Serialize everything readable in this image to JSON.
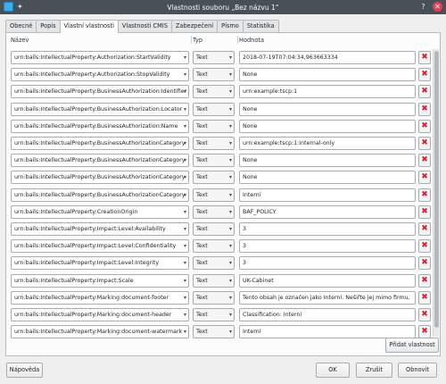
{
  "window": {
    "title": "Vlastnosti souboru „Bez názvu 1“"
  },
  "tabs": [
    {
      "label": "Obecné",
      "active": false
    },
    {
      "label": "Popis",
      "active": false
    },
    {
      "label": "Vlastní vlastnosti",
      "active": true
    },
    {
      "label": "Vlastnosti CMIS",
      "active": false
    },
    {
      "label": "Zabezpečení",
      "active": false
    },
    {
      "label": "Písmo",
      "active": false
    },
    {
      "label": "Statistika",
      "active": false
    }
  ],
  "table": {
    "headers": {
      "name": "Název",
      "type": "Typ",
      "value": "Hodnota"
    },
    "delete_glyph": "✖",
    "rows": [
      {
        "name": "urn:bails:IntellectualProperty:Authorization:StartValidity",
        "type": "Text",
        "value": "2018-07-19T07:04:34,963663334"
      },
      {
        "name": "urn:bails:IntellectualProperty:Authorization:StopValidity",
        "type": "Text",
        "value": "None"
      },
      {
        "name": "urn:bails:IntellectualProperty:BusinessAuthorization:Identifier",
        "type": "Text",
        "value": "urn:example:tscp:1"
      },
      {
        "name": "urn:bails:IntellectualProperty:BusinessAuthorization:Locator",
        "type": "Text",
        "value": "None"
      },
      {
        "name": "urn:bails:IntellectualProperty:BusinessAuthorization:Name",
        "type": "Text",
        "value": "None"
      },
      {
        "name": "urn:bails:IntellectualProperty:BusinessAuthorizationCategory",
        "type": "Text",
        "value": "urn:example:tscp:1:internal-only"
      },
      {
        "name": "urn:bails:IntellectualProperty:BusinessAuthorizationCategory",
        "type": "Text",
        "value": "None"
      },
      {
        "name": "urn:bails:IntellectualProperty:BusinessAuthorizationCategory",
        "type": "Text",
        "value": "None"
      },
      {
        "name": "urn:bails:IntellectualProperty:BusinessAuthorizationCategory",
        "type": "Text",
        "value": "Interní"
      },
      {
        "name": "urn:bails:IntellectualProperty:CreationOrigin",
        "type": "Text",
        "value": "BAF_POLICY"
      },
      {
        "name": "urn:bails:IntellectualProperty:Impact:Level:Availability",
        "type": "Text",
        "value": "3"
      },
      {
        "name": "urn:bails:IntellectualProperty:Impact:Level:Confidentiality",
        "type": "Text",
        "value": "3"
      },
      {
        "name": "urn:bails:IntellectualProperty:Impact:Level:Integrity",
        "type": "Text",
        "value": "3"
      },
      {
        "name": "urn:bails:IntellectualProperty:Impact:Scale",
        "type": "Text",
        "value": "UK-Cabinet"
      },
      {
        "name": "urn:bails:IntellectualProperty:Marking:document-footer",
        "type": "Text",
        "value": "Tento obsah je označen jako Interní. Nešiřte jej mimo firmu."
      },
      {
        "name": "urn:bails:IntellectualProperty:Marking:document-header",
        "type": "Text",
        "value": "Classification: Interní"
      },
      {
        "name": "urn:bails:IntellectualProperty:Marking:document-watermark",
        "type": "Text",
        "value": "Interní"
      }
    ]
  },
  "buttons": {
    "add_property": "Přidat vlastnost",
    "help": "Nápověda",
    "ok": "OK",
    "cancel": "Zrušit",
    "reset": "Obnovit"
  },
  "colors": {
    "titlebar": "#475057",
    "close": "#da4453",
    "delete": "#da1f2f"
  }
}
